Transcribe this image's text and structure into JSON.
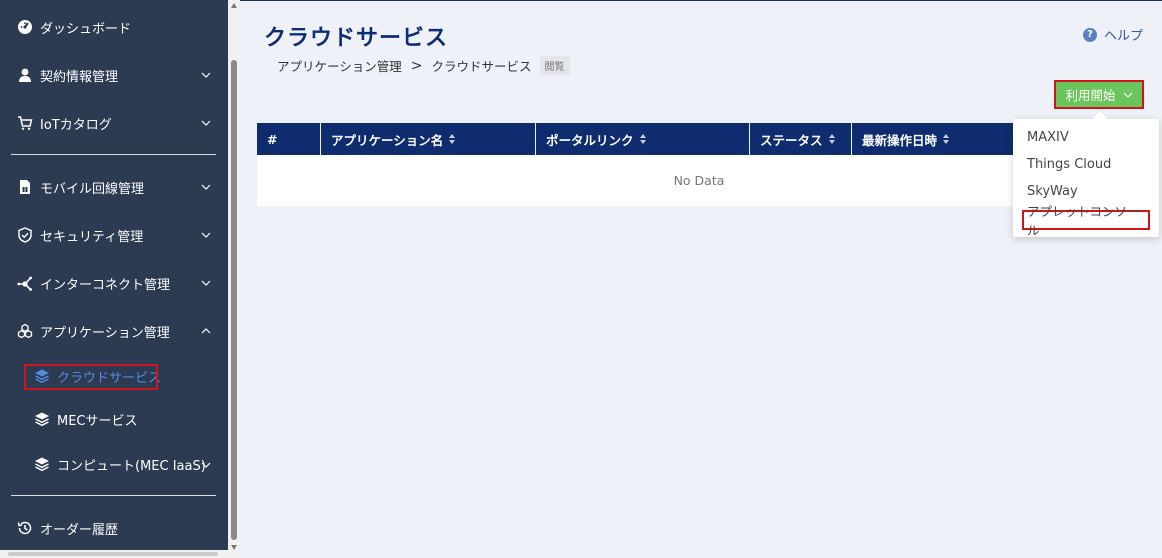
{
  "sidebar": {
    "items": [
      {
        "label": "ダッシュボード"
      },
      {
        "label": "契約情報管理"
      },
      {
        "label": "IoTカタログ"
      },
      {
        "label": "モバイル回線管理"
      },
      {
        "label": "セキュリティ管理"
      },
      {
        "label": "インターコネクト管理"
      },
      {
        "label": "アプリケーション管理"
      },
      {
        "label": "オーダー履歴"
      }
    ],
    "subitems": [
      {
        "label": "クラウドサービス"
      },
      {
        "label": "MECサービス"
      },
      {
        "label": "コンピュート(MEC IaaS)"
      }
    ]
  },
  "header": {
    "title": "クラウドサービス",
    "help_label": "ヘルプ",
    "help_icon": "?"
  },
  "breadcrumb": {
    "items": [
      "アプリケーション管理",
      "クラウドサービス"
    ],
    "separator": ">",
    "tag": "閲覧"
  },
  "start_button": {
    "label": "利用開始"
  },
  "table": {
    "columns": [
      "#",
      "アプリケーション名",
      "ポータルリンク",
      "ステータス",
      "最新操作日時"
    ],
    "empty_text": "No Data"
  },
  "dropdown": {
    "items": [
      "MAXIV",
      "Things Cloud",
      "SkyWay",
      "アプレットコンソール"
    ]
  },
  "colors": {
    "sidebar_bg": "#2c3a52",
    "accent": "#0f2d74",
    "active_sub": "#4f8de0",
    "start_button": "#6cc45c",
    "highlight_border": "#d0151a"
  }
}
